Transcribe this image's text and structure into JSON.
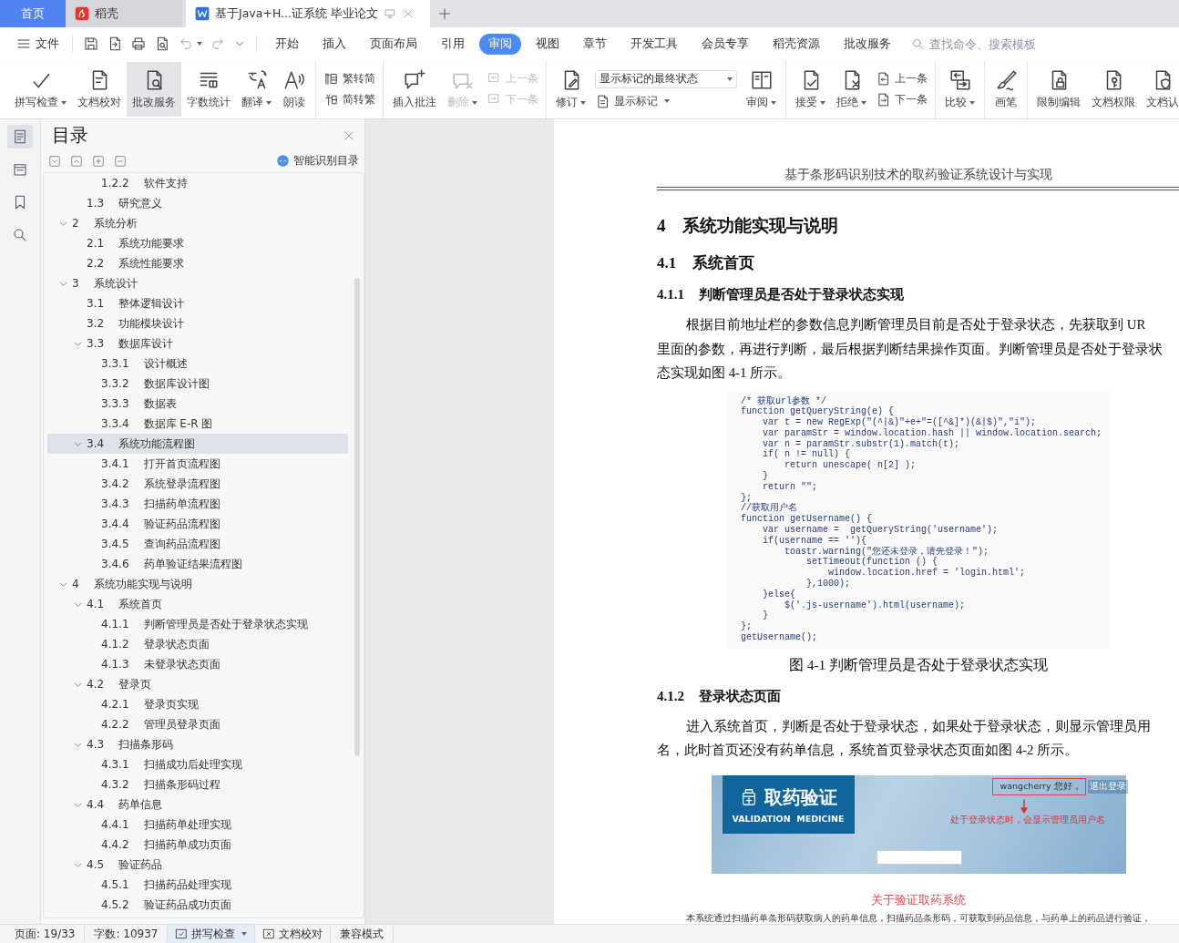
{
  "tabs": [
    {
      "kind": "home",
      "label": "首页",
      "selected": false
    },
    {
      "kind": "app",
      "label": "稻壳",
      "selected": false
    },
    {
      "kind": "doc",
      "label": "基于Java+H...证系统 毕业论文",
      "selected": true
    }
  ],
  "menu": {
    "file": "文件",
    "tabs": [
      {
        "label": "开始",
        "selected": false
      },
      {
        "label": "插入",
        "selected": false
      },
      {
        "label": "页面布局",
        "selected": false
      },
      {
        "label": "引用",
        "selected": false
      },
      {
        "label": "审阅",
        "selected": true
      },
      {
        "label": "视图",
        "selected": false
      },
      {
        "label": "章节",
        "selected": false
      },
      {
        "label": "开发工具",
        "selected": false
      },
      {
        "label": "会员专享",
        "selected": false
      },
      {
        "label": "稻壳资源",
        "selected": false
      },
      {
        "label": "批改服务",
        "selected": false
      }
    ],
    "search_placeholder": "查找命令、搜索模板"
  },
  "ribbon": [
    {
      "items": [
        {
          "kind": "big",
          "label": "拼写检查",
          "dropdown": true,
          "selected": false,
          "disabled": false
        },
        {
          "kind": "big",
          "label": "文档校对",
          "dropdown": false,
          "selected": false,
          "disabled": false
        },
        {
          "kind": "big",
          "label": "批改服务",
          "dropdown": false,
          "selected": true,
          "disabled": false
        },
        {
          "kind": "big",
          "label": "字数统计",
          "dropdown": false,
          "selected": false,
          "disabled": false
        },
        {
          "kind": "big",
          "label": "翻译",
          "dropdown": true,
          "selected": false,
          "disabled": false
        },
        {
          "kind": "big",
          "label": "朗读",
          "dropdown": false,
          "selected": false,
          "disabled": false
        }
      ]
    },
    {
      "items": [
        {
          "kind": "pair",
          "rows": [
            {
              "label": "繁转简",
              "disabled": false
            },
            {
              "label": "简转繁",
              "disabled": false
            }
          ]
        }
      ]
    },
    {
      "items": [
        {
          "kind": "big",
          "label": "插入批注",
          "dropdown": false,
          "selected": false,
          "disabled": false
        },
        {
          "kind": "big",
          "label": "删除",
          "dropdown": true,
          "selected": false,
          "disabled": true
        },
        {
          "kind": "pair",
          "rows": [
            {
              "label": "上一条",
              "disabled": true
            },
            {
              "label": "下一条",
              "disabled": true
            }
          ]
        }
      ]
    },
    {
      "items": [
        {
          "kind": "big",
          "label": "修订",
          "dropdown": true,
          "selected": false,
          "disabled": false
        },
        {
          "kind": "select",
          "value": "显示标记的最终状态",
          "rows": [
            {
              "label": "显示标记",
              "disabled": false
            }
          ]
        },
        {
          "kind": "big",
          "label": "审阅",
          "dropdown": true,
          "selected": false,
          "disabled": false
        }
      ]
    },
    {
      "items": [
        {
          "kind": "big",
          "label": "接受",
          "dropdown": true,
          "selected": false,
          "disabled": false
        },
        {
          "kind": "big",
          "label": "拒绝",
          "dropdown": true,
          "selected": false,
          "disabled": false
        },
        {
          "kind": "pair",
          "rows": [
            {
              "label": "上一条",
              "disabled": false
            },
            {
              "label": "下一条",
              "disabled": false
            }
          ]
        }
      ]
    },
    {
      "items": [
        {
          "kind": "big",
          "label": "比较",
          "dropdown": true,
          "selected": false,
          "disabled": false
        }
      ]
    },
    {
      "items": [
        {
          "kind": "big",
          "label": "画笔",
          "dropdown": false,
          "selected": false,
          "disabled": false
        }
      ]
    },
    {
      "items": [
        {
          "kind": "big",
          "label": "限制编辑",
          "dropdown": false,
          "selected": false,
          "disabled": false
        },
        {
          "kind": "big",
          "label": "文档权限",
          "dropdown": false,
          "selected": false,
          "disabled": false
        },
        {
          "kind": "big",
          "label": "文档认",
          "dropdown": false,
          "selected": false,
          "disabled": false
        }
      ]
    }
  ],
  "rail": [
    {
      "selected": true
    },
    {
      "selected": false
    },
    {
      "selected": false
    },
    {
      "selected": false
    }
  ],
  "toc": {
    "title": "目录",
    "smart_button": "智能识别目录",
    "items": [
      {
        "children": [
          {
            "children": [
              {
                "number": "1.2.2",
                "title": "软件支持",
                "selected": false
              }
            ]
          },
          {
            "number": "1.3",
            "title": "研究意义",
            "selected": false
          }
        ]
      },
      {
        "number": "2",
        "title": "系统分析",
        "selected": false,
        "expanded": true,
        "children": [
          {
            "number": "2.1",
            "title": "系统功能要求",
            "selected": false
          },
          {
            "number": "2.2",
            "title": "系统性能要求",
            "selected": false
          }
        ]
      },
      {
        "number": "3",
        "title": "系统设计",
        "selected": false,
        "expanded": true,
        "children": [
          {
            "number": "3.1",
            "title": "整体逻辑设计",
            "selected": false
          },
          {
            "number": "3.2",
            "title": "功能模块设计",
            "selected": false
          },
          {
            "number": "3.3",
            "title": "数据库设计",
            "selected": false,
            "expanded": true,
            "children": [
              {
                "number": "3.3.1",
                "title": "设计概述",
                "selected": false
              },
              {
                "number": "3.3.2",
                "title": "数据库设计图",
                "selected": false
              },
              {
                "number": "3.3.3",
                "title": "数据表",
                "selected": false
              },
              {
                "number": "3.3.4",
                "title": "数据库 E-R 图",
                "selected": false
              }
            ]
          },
          {
            "number": "3.4",
            "title": "系统功能流程图",
            "selected": true,
            "expanded": true,
            "children": [
              {
                "number": "3.4.1",
                "title": "打开首页流程图",
                "selected": false
              },
              {
                "number": "3.4.2",
                "title": "系统登录流程图",
                "selected": false
              },
              {
                "number": "3.4.3",
                "title": "扫描药单流程图",
                "selected": false
              },
              {
                "number": "3.4.4",
                "title": "验证药品流程图",
                "selected": false
              },
              {
                "number": "3.4.5",
                "title": "查询药品流程图",
                "selected": false
              },
              {
                "number": "3.4.6",
                "title": "药单验证结果流程图",
                "selected": false
              }
            ]
          }
        ]
      },
      {
        "number": "4",
        "title": "系统功能实现与说明",
        "selected": false,
        "expanded": true,
        "children": [
          {
            "number": "4.1",
            "title": "系统首页",
            "selected": false,
            "expanded": true,
            "children": [
              {
                "number": "4.1.1",
                "title": "判断管理员是否处于登录状态实现",
                "selected": false
              },
              {
                "number": "4.1.2",
                "title": "登录状态页面",
                "selected": false
              },
              {
                "number": "4.1.3",
                "title": "未登录状态页面",
                "selected": false
              }
            ]
          },
          {
            "number": "4.2",
            "title": "登录页",
            "selected": false,
            "expanded": true,
            "children": [
              {
                "number": "4.2.1",
                "title": "登录页实现",
                "selected": false
              },
              {
                "number": "4.2.2",
                "title": "管理员登录页面",
                "selected": false
              }
            ]
          },
          {
            "number": "4.3",
            "title": "扫描条形码",
            "selected": false,
            "expanded": true,
            "children": [
              {
                "number": "4.3.1",
                "title": "扫描成功后处理实现",
                "selected": false
              },
              {
                "number": "4.3.2",
                "title": "扫描条形码过程",
                "selected": false
              }
            ]
          },
          {
            "number": "4.4",
            "title": "药单信息",
            "selected": false,
            "expanded": true,
            "children": [
              {
                "number": "4.4.1",
                "title": "扫描药单处理实现",
                "selected": false
              },
              {
                "number": "4.4.2",
                "title": "扫描药单成功页面",
                "selected": false
              }
            ]
          },
          {
            "number": "4.5",
            "title": "验证药品",
            "selected": false,
            "expanded": true,
            "children": [
              {
                "number": "4.5.1",
                "title": "扫描药品处理实现",
                "selected": false
              },
              {
                "number": "4.5.2",
                "title": "验证药品成功页面",
                "selected": false
              }
            ]
          }
        ]
      }
    ]
  },
  "document": [
    {
      "kind": "header",
      "text": "基于条形码识别技术的取药验证系统设计与实现"
    },
    {
      "kind": "h1",
      "number": "4",
      "title": "系统功能实现与说明"
    },
    {
      "kind": "h2",
      "number": "4.1",
      "title": "系统首页"
    },
    {
      "kind": "h3",
      "number": "4.1.1",
      "title": "判断管理员是否处于登录状态实现"
    },
    {
      "kind": "paragraph",
      "lines": [
        "根据目前地址栏的参数信息判断管理员目前是否处于登录状态，先获取到 UR",
        "里面的参数，再进行判断，最后根据判断结果操作页面。判断管理员是否处于登录状",
        "态实现如图 4-1 所示。"
      ]
    },
    {
      "kind": "code",
      "lines": [
        "/* 获取url参数 */",
        "function getQueryString(e) {",
        "    var t = new RegExp(\"(^|&)\"+e+\"=([^&]*)(&|$)\",\"i\");",
        "    var paramStr = window.location.hash || window.location.search;",
        "    var n = paramStr.substr(1).match(t);",
        "    if( n != null) {",
        "        return unescape( n[2] );",
        "    }",
        "    return \"\";",
        "};",
        "//获取用户名",
        "function getUsername() {",
        "    var username =  getQueryString('username');",
        "    if(username == ''){",
        "        toastr.warning(\"您还未登录，请先登录！\");",
        "            setTimeout(function () {",
        "                window.location.href = 'login.html';",
        "            },1000);",
        "    }else{",
        "        $('.js-username').html(username);",
        "    }",
        "};",
        "getUsername();"
      ]
    },
    {
      "kind": "caption",
      "text": "图 4-1  判断管理员是否处于登录状态实现"
    },
    {
      "kind": "h3",
      "number": "4.1.2",
      "title": "登录状态页面"
    },
    {
      "kind": "paragraph",
      "lines": [
        "进入系统首页，判断是否处于登录状态，如果处于登录状态，则显示管理员用",
        "名，此时首页还没有药单信息，系统首页登录状态页面如图 4-2 所示。"
      ]
    },
    {
      "kind": "webpage",
      "logo_title": "取药验证",
      "logo_subtitle": "VALIDATION  MEDICINE",
      "greeting": "wangcherry 您好，",
      "logout": "退出登录",
      "note": "处于登录状态时，会显示管理员用户名",
      "about_title": "关于验证取药系统",
      "about_lines": [
        "本系统通过扫描药单条形码获取病人的药单信息，扫描药品条形码，可获取到药品信息，与药单上的药品进行验证，"
      ]
    }
  ],
  "status": [
    {
      "kind": "text",
      "label": "页面: 19/33"
    },
    {
      "kind": "text",
      "label": "字数: 10937"
    },
    {
      "kind": "toggle",
      "label": "拼写检查",
      "dropdown": true
    },
    {
      "kind": "toggle",
      "label": "文档校对",
      "dropdown": false
    },
    {
      "kind": "text",
      "label": "兼容模式"
    }
  ]
}
